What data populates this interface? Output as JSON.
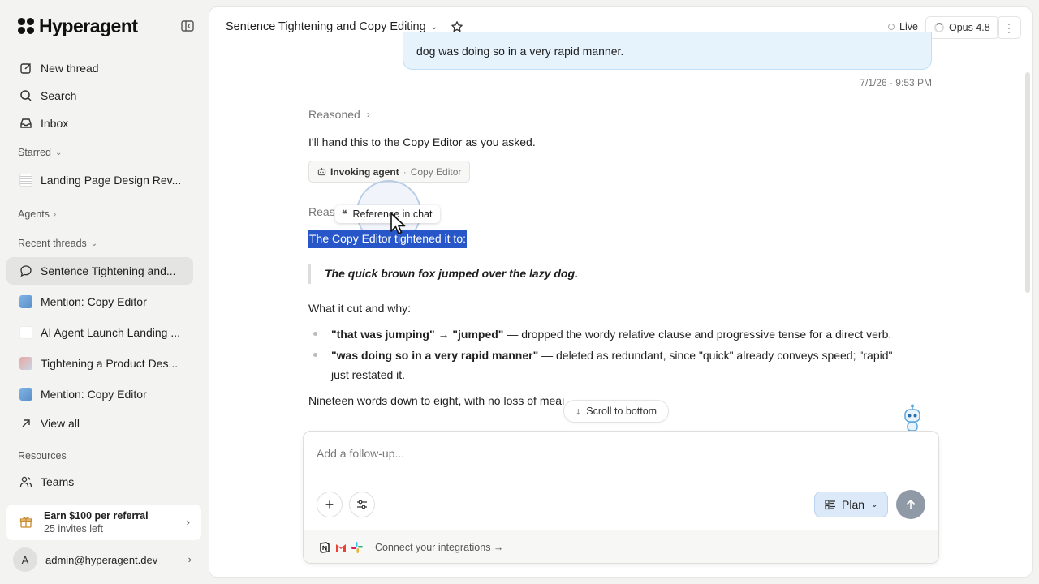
{
  "app": {
    "name": "Hyperagent"
  },
  "sidebar": {
    "new_thread": "New thread",
    "search": "Search",
    "inbox": "Inbox",
    "starred_label": "Starred",
    "starred_items": [
      {
        "label": "Landing Page Design Rev..."
      }
    ],
    "agents_label": "Agents",
    "recent_label": "Recent threads",
    "recent_items": [
      {
        "label": "Sentence Tightening and...",
        "icon": "chat-bubble-icon",
        "active": true
      },
      {
        "label": "Mention: Copy Editor",
        "icon": "thread-thumbnail"
      },
      {
        "label": "AI Agent Launch Landing ...",
        "icon": "thread-thumbnail"
      },
      {
        "label": "Tightening a Product Des...",
        "icon": "thread-thumbnail"
      },
      {
        "label": "Mention: Copy Editor",
        "icon": "thread-thumbnail"
      }
    ],
    "view_all": "View all",
    "resources_label": "Resources",
    "teams": "Teams",
    "referral": {
      "title": "Earn $100 per referral",
      "subtitle": "25 invites left"
    },
    "account": {
      "initial": "A",
      "email": "admin@hyperagent.dev"
    }
  },
  "header": {
    "thread_title": "Sentence Tightening and Copy Editing",
    "live_label": "Live",
    "model_label": "Opus 4.8"
  },
  "conversation": {
    "user_message_tail": "dog was doing so in a very rapid manner.",
    "timestamp": "7/1/26 · 9:53 PM",
    "reasoned_label": "Reasoned",
    "handoff_text": "I'll hand this to the Copy Editor as you asked.",
    "agent_chip": {
      "action": "Invoking agent",
      "separator": "·",
      "agent": "Copy Editor"
    },
    "reasoned_partial": "Reas",
    "reference_popup": "Reference in chat",
    "selected_text": "The Copy Editor tightened it to:",
    "quote": "The quick brown fox jumped over the lazy dog.",
    "cuts_heading": "What it cut and why:",
    "bullets": [
      {
        "bold": "\"that was jumping\" → \"jumped\"",
        "rest": " — dropped the wordy relative clause and progressive tense for a direct verb."
      },
      {
        "bold": "\"was doing so in a very rapid manner\"",
        "rest": " — deleted as redundant, since \"quick\" already conveys speed; \"rapid\" just restated it."
      }
    ],
    "summary": "Nineteen words down to eight, with no loss of mea",
    "summary_tail": "i"
  },
  "scroll_to_bottom": "Scroll to bottom",
  "composer": {
    "placeholder": "Add a follow-up...",
    "plan_label": "Plan",
    "connect_label": "Connect your integrations →"
  },
  "colors": {
    "selection": "#2756c9",
    "bubble": "#e6f3fd",
    "plan_button": "#dbe9f8",
    "send_button": "#8f9aa6"
  }
}
